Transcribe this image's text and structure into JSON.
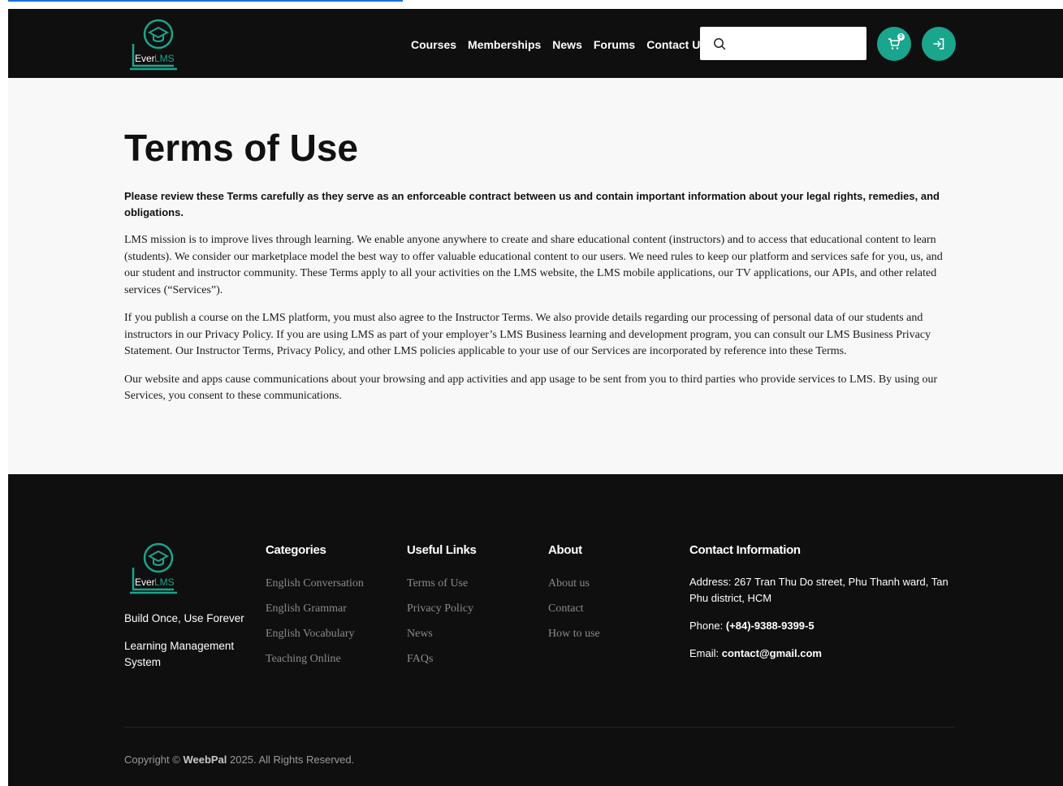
{
  "colors": {
    "accent": "#1aa58d",
    "header_bg": "#0f0f0f",
    "page_bg": "#f8f8f8",
    "footer_link": "#8a8a8a"
  },
  "brand": {
    "logo_prefix": "Ever",
    "logo_suffix": "LMS"
  },
  "nav": {
    "items": [
      {
        "label": "Courses"
      },
      {
        "label": "Memberships"
      },
      {
        "label": "News"
      },
      {
        "label": "Forums"
      },
      {
        "label": "Contact Us"
      }
    ]
  },
  "search": {
    "value": "",
    "placeholder": ""
  },
  "cart": {
    "count": "0",
    "icon": "cart-icon"
  },
  "login": {
    "icon": "login-icon"
  },
  "page": {
    "title": "Terms of Use",
    "lead": "Please review these Terms carefully as they serve as an enforceable contract between us and contain important information about your legal rights, remedies, and obligations.",
    "paragraphs": [
      "LMS mission is to improve lives through learning. We enable anyone anywhere to create and share educational content (instructors) and to access that educational content to learn (students). We consider our marketplace model the best way to offer valuable educational content to our users. We need rules to keep our platform and services safe for you, us, and our student and instructor community. These Terms apply to all your activities on the LMS website, the LMS mobile applications, our TV applications, our APIs, and other related services (“Services”).",
      "If you publish a course on the LMS platform, you must also agree to the Instructor Terms. We also provide details regarding our processing of personal data of our students and instructors in our Privacy Policy. If you are using LMS as part of your employer’s LMS Business learning and development program, you can consult our LMS Business Privacy Statement. Our Instructor Terms, Privacy Policy, and other LMS policies applicable to your use of our Services are incorporated by reference into these Terms.",
      "Our website and apps cause communications about your browsing and app activities and app usage to be sent from you to third parties who provide services to LMS. By using our Services, you consent to these communications."
    ]
  },
  "footer": {
    "tagline": "Build Once, Use Forever",
    "subtitle": "Learning Management System",
    "categories": {
      "title": "Categories",
      "items": [
        "English Conversation",
        "English Grammar",
        "English Vocabulary",
        "Teaching Online"
      ]
    },
    "useful_links": {
      "title": "Useful Links",
      "items": [
        "Terms of Use",
        "Privacy Policy",
        "News",
        "FAQs"
      ]
    },
    "about": {
      "title": "About",
      "items": [
        "About us",
        "Contact",
        "How to use"
      ]
    },
    "contact": {
      "title": "Contact Information",
      "address_label": "Address:",
      "address": "267 Tran Thu Do street, Phu Thanh ward, Tan Phu district, HCM",
      "phone_label": "Phone:",
      "phone": "(+84)-9388-9399-5",
      "email_label": "Email:",
      "email": "contact@gmail.com"
    },
    "copyright_prefix": "Copyright ©",
    "copyright_brand": "WeebPal",
    "copyright_suffix": "2025. All Rights Reserved."
  }
}
